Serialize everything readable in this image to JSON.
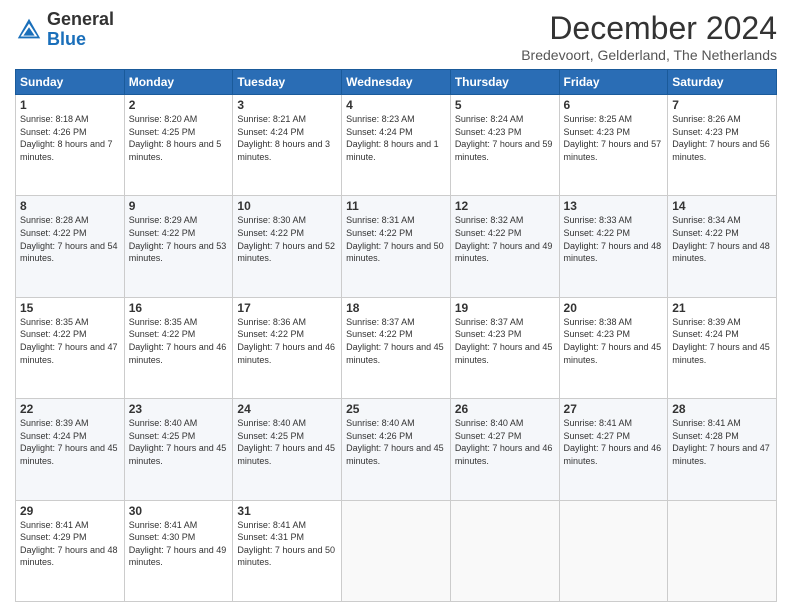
{
  "logo": {
    "general": "General",
    "blue": "Blue"
  },
  "header": {
    "month_title": "December 2024",
    "subtitle": "Bredevoort, Gelderland, The Netherlands"
  },
  "days_of_week": [
    "Sunday",
    "Monday",
    "Tuesday",
    "Wednesday",
    "Thursday",
    "Friday",
    "Saturday"
  ],
  "weeks": [
    [
      {
        "day": "1",
        "sunrise": "8:18 AM",
        "sunset": "4:26 PM",
        "daylight": "8 hours and 7 minutes."
      },
      {
        "day": "2",
        "sunrise": "8:20 AM",
        "sunset": "4:25 PM",
        "daylight": "8 hours and 5 minutes."
      },
      {
        "day": "3",
        "sunrise": "8:21 AM",
        "sunset": "4:24 PM",
        "daylight": "8 hours and 3 minutes."
      },
      {
        "day": "4",
        "sunrise": "8:23 AM",
        "sunset": "4:24 PM",
        "daylight": "8 hours and 1 minute."
      },
      {
        "day": "5",
        "sunrise": "8:24 AM",
        "sunset": "4:23 PM",
        "daylight": "7 hours and 59 minutes."
      },
      {
        "day": "6",
        "sunrise": "8:25 AM",
        "sunset": "4:23 PM",
        "daylight": "7 hours and 57 minutes."
      },
      {
        "day": "7",
        "sunrise": "8:26 AM",
        "sunset": "4:23 PM",
        "daylight": "7 hours and 56 minutes."
      }
    ],
    [
      {
        "day": "8",
        "sunrise": "8:28 AM",
        "sunset": "4:22 PM",
        "daylight": "7 hours and 54 minutes."
      },
      {
        "day": "9",
        "sunrise": "8:29 AM",
        "sunset": "4:22 PM",
        "daylight": "7 hours and 53 minutes."
      },
      {
        "day": "10",
        "sunrise": "8:30 AM",
        "sunset": "4:22 PM",
        "daylight": "7 hours and 52 minutes."
      },
      {
        "day": "11",
        "sunrise": "8:31 AM",
        "sunset": "4:22 PM",
        "daylight": "7 hours and 50 minutes."
      },
      {
        "day": "12",
        "sunrise": "8:32 AM",
        "sunset": "4:22 PM",
        "daylight": "7 hours and 49 minutes."
      },
      {
        "day": "13",
        "sunrise": "8:33 AM",
        "sunset": "4:22 PM",
        "daylight": "7 hours and 48 minutes."
      },
      {
        "day": "14",
        "sunrise": "8:34 AM",
        "sunset": "4:22 PM",
        "daylight": "7 hours and 48 minutes."
      }
    ],
    [
      {
        "day": "15",
        "sunrise": "8:35 AM",
        "sunset": "4:22 PM",
        "daylight": "7 hours and 47 minutes."
      },
      {
        "day": "16",
        "sunrise": "8:35 AM",
        "sunset": "4:22 PM",
        "daylight": "7 hours and 46 minutes."
      },
      {
        "day": "17",
        "sunrise": "8:36 AM",
        "sunset": "4:22 PM",
        "daylight": "7 hours and 46 minutes."
      },
      {
        "day": "18",
        "sunrise": "8:37 AM",
        "sunset": "4:22 PM",
        "daylight": "7 hours and 45 minutes."
      },
      {
        "day": "19",
        "sunrise": "8:37 AM",
        "sunset": "4:23 PM",
        "daylight": "7 hours and 45 minutes."
      },
      {
        "day": "20",
        "sunrise": "8:38 AM",
        "sunset": "4:23 PM",
        "daylight": "7 hours and 45 minutes."
      },
      {
        "day": "21",
        "sunrise": "8:39 AM",
        "sunset": "4:24 PM",
        "daylight": "7 hours and 45 minutes."
      }
    ],
    [
      {
        "day": "22",
        "sunrise": "8:39 AM",
        "sunset": "4:24 PM",
        "daylight": "7 hours and 45 minutes."
      },
      {
        "day": "23",
        "sunrise": "8:40 AM",
        "sunset": "4:25 PM",
        "daylight": "7 hours and 45 minutes."
      },
      {
        "day": "24",
        "sunrise": "8:40 AM",
        "sunset": "4:25 PM",
        "daylight": "7 hours and 45 minutes."
      },
      {
        "day": "25",
        "sunrise": "8:40 AM",
        "sunset": "4:26 PM",
        "daylight": "7 hours and 45 minutes."
      },
      {
        "day": "26",
        "sunrise": "8:40 AM",
        "sunset": "4:27 PM",
        "daylight": "7 hours and 46 minutes."
      },
      {
        "day": "27",
        "sunrise": "8:41 AM",
        "sunset": "4:27 PM",
        "daylight": "7 hours and 46 minutes."
      },
      {
        "day": "28",
        "sunrise": "8:41 AM",
        "sunset": "4:28 PM",
        "daylight": "7 hours and 47 minutes."
      }
    ],
    [
      {
        "day": "29",
        "sunrise": "8:41 AM",
        "sunset": "4:29 PM",
        "daylight": "7 hours and 48 minutes."
      },
      {
        "day": "30",
        "sunrise": "8:41 AM",
        "sunset": "4:30 PM",
        "daylight": "7 hours and 49 minutes."
      },
      {
        "day": "31",
        "sunrise": "8:41 AM",
        "sunset": "4:31 PM",
        "daylight": "7 hours and 50 minutes."
      },
      null,
      null,
      null,
      null
    ]
  ],
  "labels": {
    "sunrise": "Sunrise:",
    "sunset": "Sunset:",
    "daylight": "Daylight:"
  }
}
